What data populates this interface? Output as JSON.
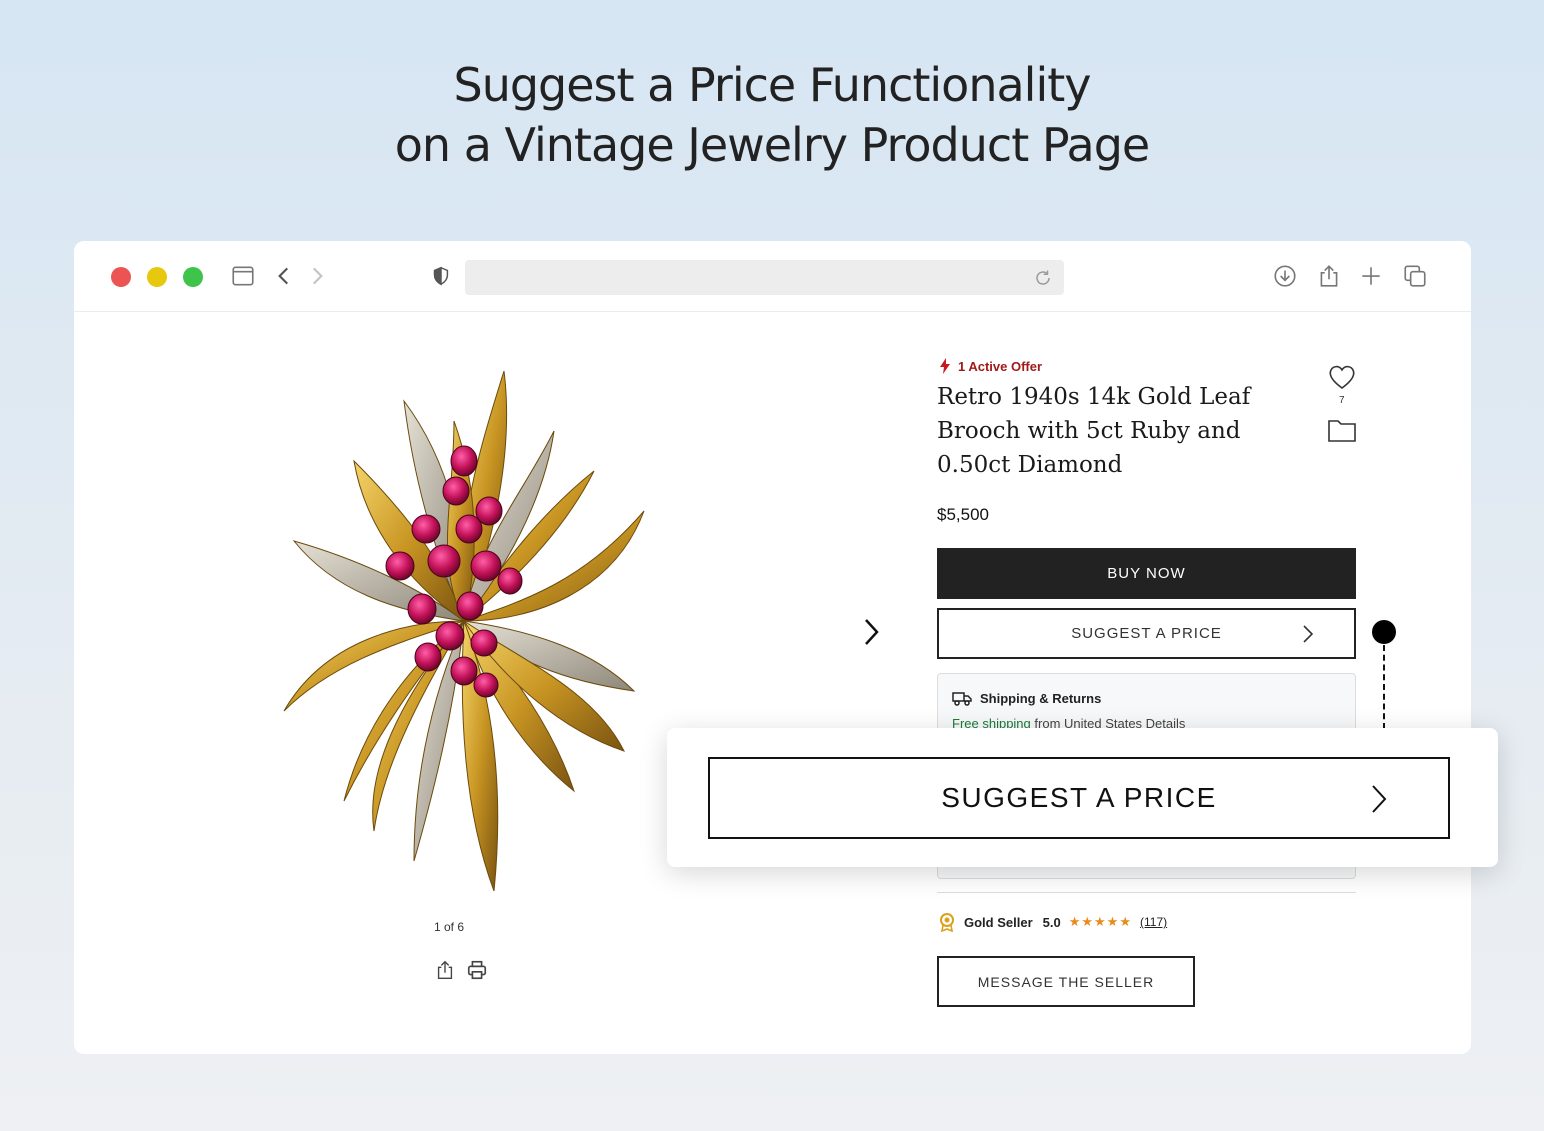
{
  "headline": {
    "line1": "Suggest a Price Functionality",
    "line2": "on a Vintage Jewelry Product Page"
  },
  "browser": {
    "traffic_lights": [
      "#ec5454",
      "#e6c90f",
      "#3ec44b"
    ],
    "toolbar_icons": [
      "sidebar-icon",
      "back-icon",
      "forward-icon",
      "shield-icon",
      "reload-icon",
      "download-icon",
      "share-icon",
      "new-tab-icon",
      "tabs-icon"
    ]
  },
  "gallery": {
    "counter": "1 of 6",
    "tools": [
      "share-icon",
      "print-icon"
    ]
  },
  "product": {
    "offer_label": "1 Active Offer",
    "title": "Retro 1940s 14k Gold Leaf Brooch with 5ct Ruby and 0.50ct Diamond",
    "favorites_count": "7",
    "price": "$5,500",
    "buy_label": "BUY NOW",
    "suggest_label": "SUGGEST A PRICE",
    "shipping_title": "Shipping & Returns",
    "shipping_free": "Free shipping",
    "shipping_rest": " from United States Details",
    "seller_badge": "Gold Seller",
    "seller_rating": "5.0",
    "seller_stars": "★★★★★",
    "seller_reviews": "(117)",
    "message_label": "MESSAGE THE SELLER"
  },
  "callout": {
    "label": "SUGGEST A PRICE"
  },
  "colors": {
    "accent_red": "#a01a1a",
    "star_orange": "#e98a1b",
    "ship_green": "#1a7a3b",
    "button_dark": "#222222"
  }
}
